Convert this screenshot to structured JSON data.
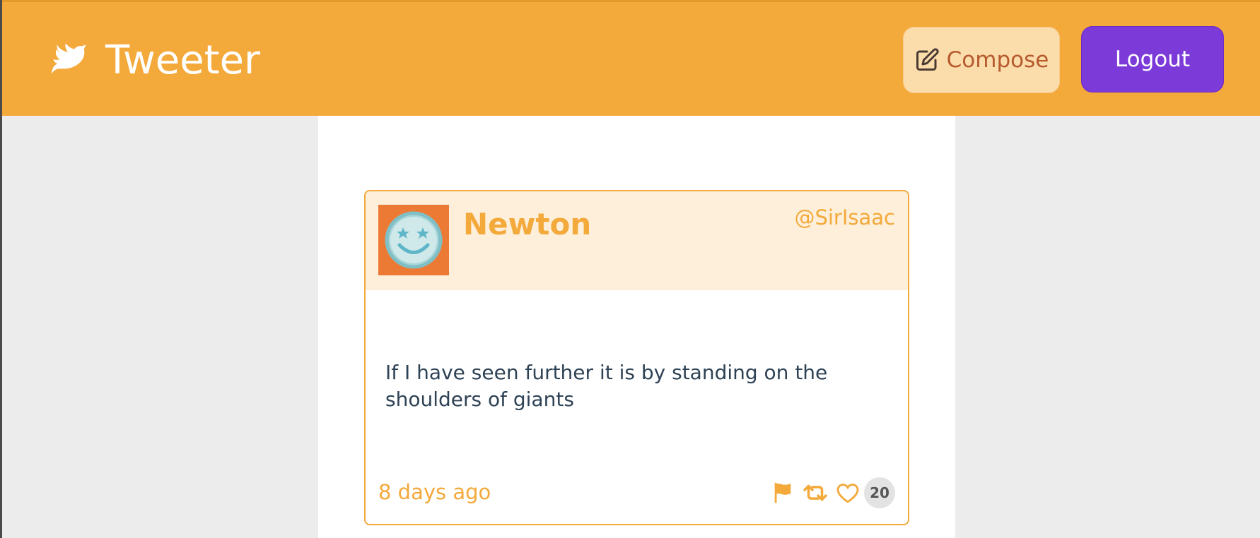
{
  "app": {
    "title": "Tweeter",
    "icon": "dove-icon"
  },
  "header": {
    "compose_label": "Compose",
    "compose_icon": "pencil-square-icon",
    "logout_label": "Logout"
  },
  "colors": {
    "header_bg": "#f4a93b",
    "accent": "#f4a93b",
    "compose_bg": "#fbdcab",
    "logout_bg": "#7c3ad8",
    "avatar_bg": "#ec7a35"
  },
  "tweet": {
    "name": "Newton",
    "handle": "@SirIsaac",
    "text": "If I have seen further it is by standing on the shoulders of giants",
    "time": "8 days ago",
    "like_count": "20",
    "actions": [
      "flag-icon",
      "retweet-icon",
      "heart-icon"
    ]
  }
}
